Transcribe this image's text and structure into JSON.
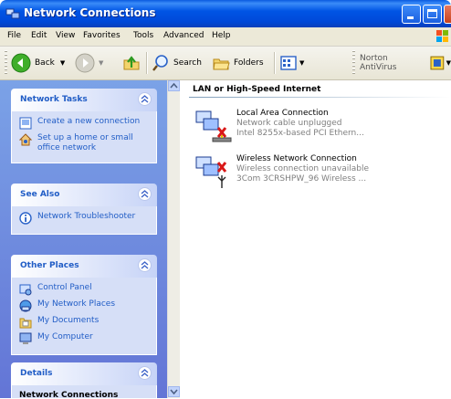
{
  "window": {
    "title": "Network Connections"
  },
  "menu": [
    "File",
    "Edit",
    "View",
    "Favorites",
    "Tools",
    "Advanced",
    "Help"
  ],
  "toolbar": {
    "back_label": "Back",
    "search_label": "Search",
    "folders_label": "Folders",
    "norton_label": "Norton AntiVirus"
  },
  "taskpane": {
    "network_tasks": {
      "title": "Network Tasks",
      "items": [
        {
          "label": "Create a new connection",
          "icon": "new-connection-icon"
        },
        {
          "label": "Set up a home or small office network",
          "icon": "home-network-icon"
        }
      ]
    },
    "see_also": {
      "title": "See Also",
      "items": [
        {
          "label": "Network Troubleshooter",
          "icon": "info-icon"
        }
      ]
    },
    "other_places": {
      "title": "Other Places",
      "items": [
        {
          "label": "Control Panel",
          "icon": "control-panel-icon"
        },
        {
          "label": "My Network Places",
          "icon": "network-places-icon"
        },
        {
          "label": "My Documents",
          "icon": "documents-folder-icon"
        },
        {
          "label": "My Computer",
          "icon": "computer-icon"
        }
      ]
    },
    "details": {
      "title": "Details",
      "subtitle": "Network Connections"
    }
  },
  "content": {
    "group_header": "LAN or High-Speed Internet",
    "connections": [
      {
        "name": "Local Area Connection",
        "status": "Network cable unplugged",
        "device": "Intel 8255x-based PCI Ethern..."
      },
      {
        "name": "Wireless Network Connection",
        "status": "Wireless connection unavailable",
        "device": "3Com 3CRSHPW_96 Wireless ..."
      }
    ]
  },
  "colors": {
    "titlebar": "#0055e5",
    "taskpane_bg": "#6f8fe0",
    "link": "#215dc6",
    "panel_body": "#d6dff7"
  }
}
